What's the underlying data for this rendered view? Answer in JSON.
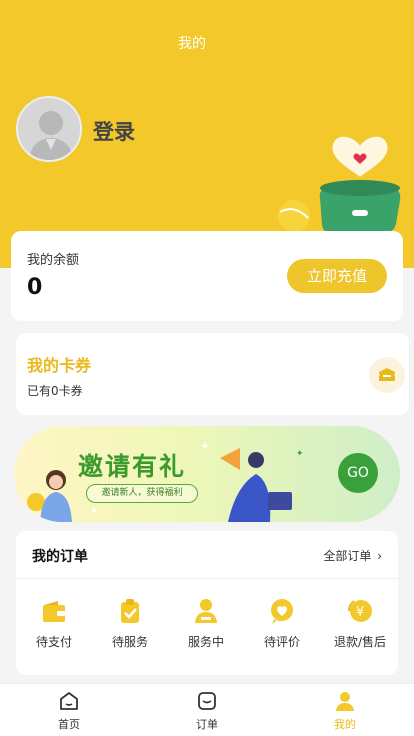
{
  "header": {
    "title": "我的"
  },
  "profile": {
    "login_label": "登录"
  },
  "balance": {
    "label": "我的余额",
    "value": "0",
    "recharge_label": "立即充值"
  },
  "coupon": {
    "title": "我的卡券",
    "subtitle": "已有0卡券"
  },
  "banner": {
    "title": "邀请有礼",
    "subtitle": "邀请新人，获得福利",
    "go_label": "GO"
  },
  "orders": {
    "title": "我的订单",
    "all_label": "全部订单",
    "items": [
      {
        "label": "待支付",
        "icon": "wallet-icon"
      },
      {
        "label": "待服务",
        "icon": "clipboard-check-icon"
      },
      {
        "label": "服务中",
        "icon": "service-person-icon"
      },
      {
        "label": "待评价",
        "icon": "heart-bubble-icon"
      },
      {
        "label": "退款/售后",
        "icon": "refund-yen-icon"
      }
    ]
  },
  "tabbar": {
    "items": [
      {
        "label": "首页",
        "icon": "home-icon",
        "active": false
      },
      {
        "label": "订单",
        "icon": "order-icon",
        "active": false
      },
      {
        "label": "我的",
        "icon": "profile-icon",
        "active": true
      }
    ]
  },
  "colors": {
    "brand_yellow": "#f2c82a",
    "accent_text": "#e9b91c",
    "green": "#3aa03a"
  }
}
